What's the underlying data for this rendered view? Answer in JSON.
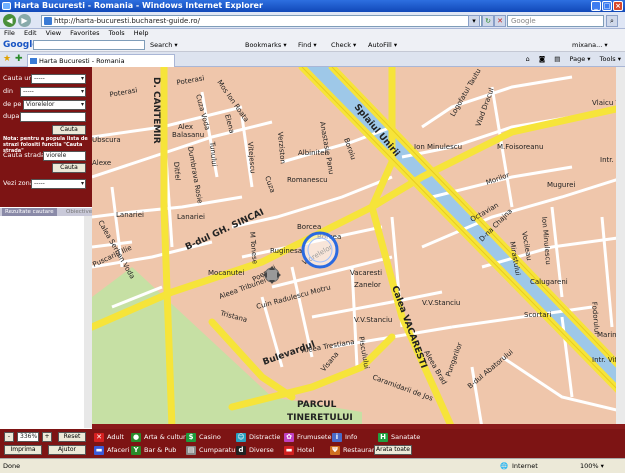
{
  "window": {
    "title": "Harta Bucuresti - Romania - Windows Internet Explorer",
    "min": "_",
    "max": "□",
    "close": "×"
  },
  "address": {
    "url": "http://harta-bucuresti.bucharest-guide.ro/",
    "search_placeholder": "Google",
    "back": "◀",
    "forward": "▶"
  },
  "menu": [
    "File",
    "Edit",
    "View",
    "Favorites",
    "Tools",
    "Help"
  ],
  "google": {
    "logo": "Google",
    "search": "Search ▾",
    "bookmarks": "Bookmarks ▾",
    "find": "Find ▾",
    "check": "Check ▾",
    "autofill": "AutoFill ▾",
    "user": "mixana... ▾"
  },
  "tab": {
    "label": "Harta Bucuresti - Romania",
    "page": "Page ▾",
    "tools": "Tools ▾"
  },
  "sidebar": {
    "cauta_label": "Cauta un",
    "cauta_value": "-----",
    "din_label": "din",
    "din_value": "-----",
    "depe_label": "de pe",
    "depe_value": "Viorelelor",
    "dupa_label": "dupa",
    "dupa_value": "",
    "cauta_btn": "Cauta",
    "note": "Nota: pentru a popula lista de strazi folositi functia \"Cauta strada\"",
    "strada_label": "Cauta strada",
    "strada_value": "viorele",
    "strada_btn": "Cauta",
    "zona_label": "Vezi zona",
    "zona_value": "-----",
    "tab1": "Rezultate cautare",
    "tab2": "Obiective"
  },
  "map_labels": {
    "cantemir": "D. CANTEMIR",
    "poterasi1": "Poterasi",
    "poterasi2": "Poterasi",
    "ion_raota": "Mos Ion Roata",
    "alex": "Alex",
    "balasanu": "Balasanu",
    "elena": "Elena",
    "cuza_voda": "Cuza Voda",
    "dumbrava": "Dumbrava Rosie",
    "tunului": "Tunului",
    "ditfel": "Ditfel",
    "vitejescu": "Vitejescu",
    "verziston": "Verziston",
    "albinitei": "Albinitei",
    "romanescu": "Romanescu",
    "cuza": "Cuza",
    "anastasie": "Anastasie Panu",
    "boroiu": "Boroiu",
    "splaiul": "Splaiul Unirii",
    "ion_minulescu": "Ion Minulescu",
    "foisoreanu": "M.Foisoreanu",
    "vlad": "Vlad Dracul",
    "logofatul": "Logofatul Tautu",
    "vlaicu": "Vlaicu V",
    "ubscura": "Ubscura",
    "alexe": "Alexe",
    "lanariei1": "Lanariei",
    "lanariei2": "Lanariei",
    "calea_serban": "Calea Serban Voda",
    "puscariu": "Puscariu Ilie",
    "sincai": "B-dul GH. SINCAI",
    "rugineasa": "Ruginesa",
    "borcea1": "Borcea",
    "borcea2": "Borcea",
    "tonese": "M Tonese",
    "viorelelor": "Viorelelor",
    "mocanu": "Mocanutei",
    "poenari": "Poenari",
    "vacaresti_st": "Vacaresti",
    "zanelor": "Zanelor",
    "alcaz": "Aleea Tribunei",
    "cuin": "Cuin Radulescu Motru",
    "tristana": "Tristana",
    "vvstanciu1": "V.V.Stanciu",
    "vvstanciu2": "V.V.Stanciu",
    "calea_vacaresti": "Calea VACARESTI",
    "aleea_trestiana": "Aleea Trestiana",
    "bulevardul": "Bulevardul",
    "visana": "Visana",
    "pisculul": "Pisculului",
    "caramidari": "Caramidarii de Jos",
    "abatorului": "B-dul Abatorului",
    "calugareni": "Calugareni",
    "scortei": "Scortari",
    "parcul": "PARCUL",
    "tineretului": "TINERETULUI",
    "morilor": "Morilor",
    "mugurei": "Mugurei",
    "octavian": "Octavian",
    "chajna": "D-na Chajna",
    "mirastu": "Mirastului",
    "doroja": "Vocileau",
    "minulescu2": "Ion Minulescu",
    "intr_pt": "Intr. Pt",
    "cuza2": "Cuza",
    "folorului": "Fodorului",
    "intr_viteazu": "Intr. Viteazu",
    "pungarilor": "Pungarilor",
    "aleea_brad": "Aleea Brad",
    "marin": "Marin"
  },
  "bottom": {
    "zoom": "336%",
    "minus": "-",
    "plus": "+",
    "reset": "Reset",
    "imprima": "Imprima",
    "ajutor": "Ajutor",
    "legend": [
      {
        "label": "Adult",
        "color": "#d62020",
        "glyph": "✕"
      },
      {
        "label": "Arta & cultura",
        "color": "#2a8a2a",
        "glyph": "●"
      },
      {
        "label": "Casino",
        "color": "#1e9a3c",
        "glyph": "$"
      },
      {
        "label": "Distractie",
        "color": "#2aa0c0",
        "glyph": "☺"
      },
      {
        "label": "Frumusete",
        "color": "#c040c0",
        "glyph": "✿"
      },
      {
        "label": "Info",
        "color": "#4a6ac8",
        "glyph": "i"
      },
      {
        "label": "Sanatate",
        "color": "#20a040",
        "glyph": "H"
      },
      {
        "label": "Afaceri",
        "color": "#3a5ad8",
        "glyph": "▬"
      },
      {
        "label": "Bar & Pub",
        "color": "#2a8a2a",
        "glyph": "Y"
      },
      {
        "label": "Cumparaturi",
        "color": "#888888",
        "glyph": "▤"
      },
      {
        "label": "Diverse",
        "color": "#222222",
        "glyph": "d"
      },
      {
        "label": "Hotel",
        "color": "#d02020",
        "glyph": "▬"
      },
      {
        "label": "Restaurant",
        "color": "#d07020",
        "glyph": "Ψ"
      }
    ],
    "arata_toate": "Arata toate"
  },
  "status": {
    "left": "Done",
    "zone": "Internet",
    "zoom": "100% ▾"
  }
}
